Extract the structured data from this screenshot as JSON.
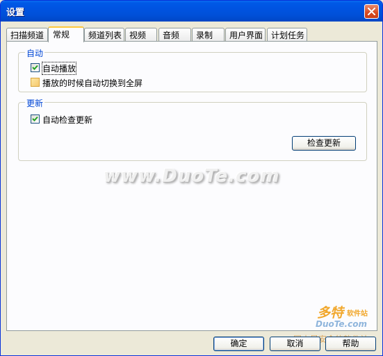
{
  "window": {
    "title": "设置"
  },
  "tabs": [
    "扫描频道",
    "常规",
    "频道列表",
    "视频",
    "音频",
    "录制",
    "用户界面",
    "计划任务"
  ],
  "active_tab": "常规",
  "groups": {
    "auto": {
      "label": "自动",
      "options": [
        {
          "label": "自动播放",
          "checked": true
        },
        {
          "label": "播放的时候自动切换到全屏",
          "checked": false
        }
      ]
    },
    "update": {
      "label": "更新",
      "options": [
        {
          "label": "自动检查更新",
          "checked": true
        }
      ],
      "check_button": "检查更新"
    }
  },
  "buttons": {
    "ok": "确定",
    "cancel": "取消",
    "help": "帮助"
  },
  "watermark": {
    "text": "www.DuoTe.com",
    "corner_title": "多特",
    "corner_sub": "软件站",
    "corner_domain": "DuoTe.com",
    "corner_zh": "国内最安全的软件站"
  },
  "colors": {
    "title_bar": "#0054e3",
    "group_label": "#0046d5",
    "active_tab_accent": "#ffc83c",
    "dialog_bg": "#ece9d8"
  },
  "icons": {
    "close": "close-icon",
    "check": "check-icon"
  }
}
